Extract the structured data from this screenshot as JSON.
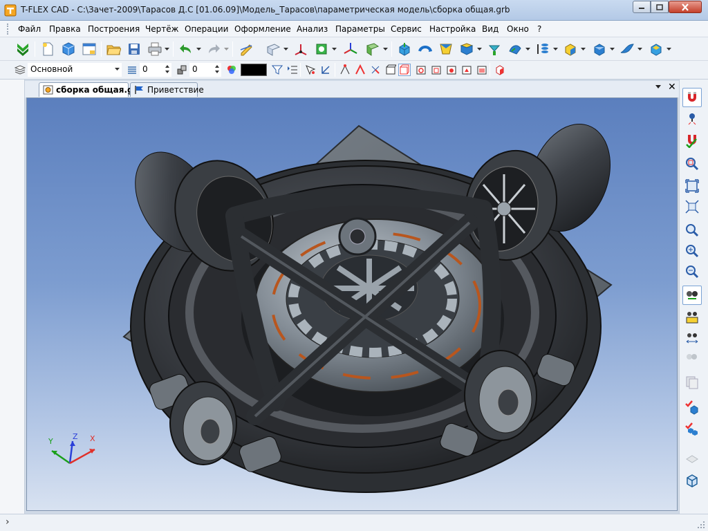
{
  "window": {
    "title": "T-FLEX CAD - C:\\Зачет-2009\\Тарасов Д.С [01.06.09]\\Модель_Тарасов\\параметрическая модель\\сборка общая.grb"
  },
  "menu": {
    "items": [
      {
        "label": "Файл"
      },
      {
        "label": "Правка"
      },
      {
        "label": "Построения"
      },
      {
        "label": "Чертёж"
      },
      {
        "label": "Операции"
      },
      {
        "label": "Оформление"
      },
      {
        "label": "Анализ"
      },
      {
        "label": "Параметры"
      },
      {
        "label": "Сервис"
      },
      {
        "label": "Настройка"
      },
      {
        "label": "Вид"
      },
      {
        "label": "Окно"
      },
      {
        "label": "?"
      }
    ]
  },
  "toolbar2": {
    "layer_value": "Основной",
    "level_value": "0",
    "priority_value": "0",
    "color_value": "#000000"
  },
  "tabs": [
    {
      "label": "сборка общая.grb",
      "active": true
    },
    {
      "label": "Приветствие",
      "active": false
    }
  ],
  "tabs_close_label": "✕",
  "axes": {
    "x": "X",
    "y": "Y",
    "z": "Z"
  },
  "status": {
    "chevron": "›"
  },
  "colors": {
    "viewport_top": "#5b7fbe",
    "viewport_bottom": "#d8e2f1",
    "model_dark": "#3a3d42",
    "model_light": "#8e969e",
    "axis_x": "#e0302a",
    "axis_y": "#1aa01a",
    "axis_z": "#2a3fd8"
  }
}
